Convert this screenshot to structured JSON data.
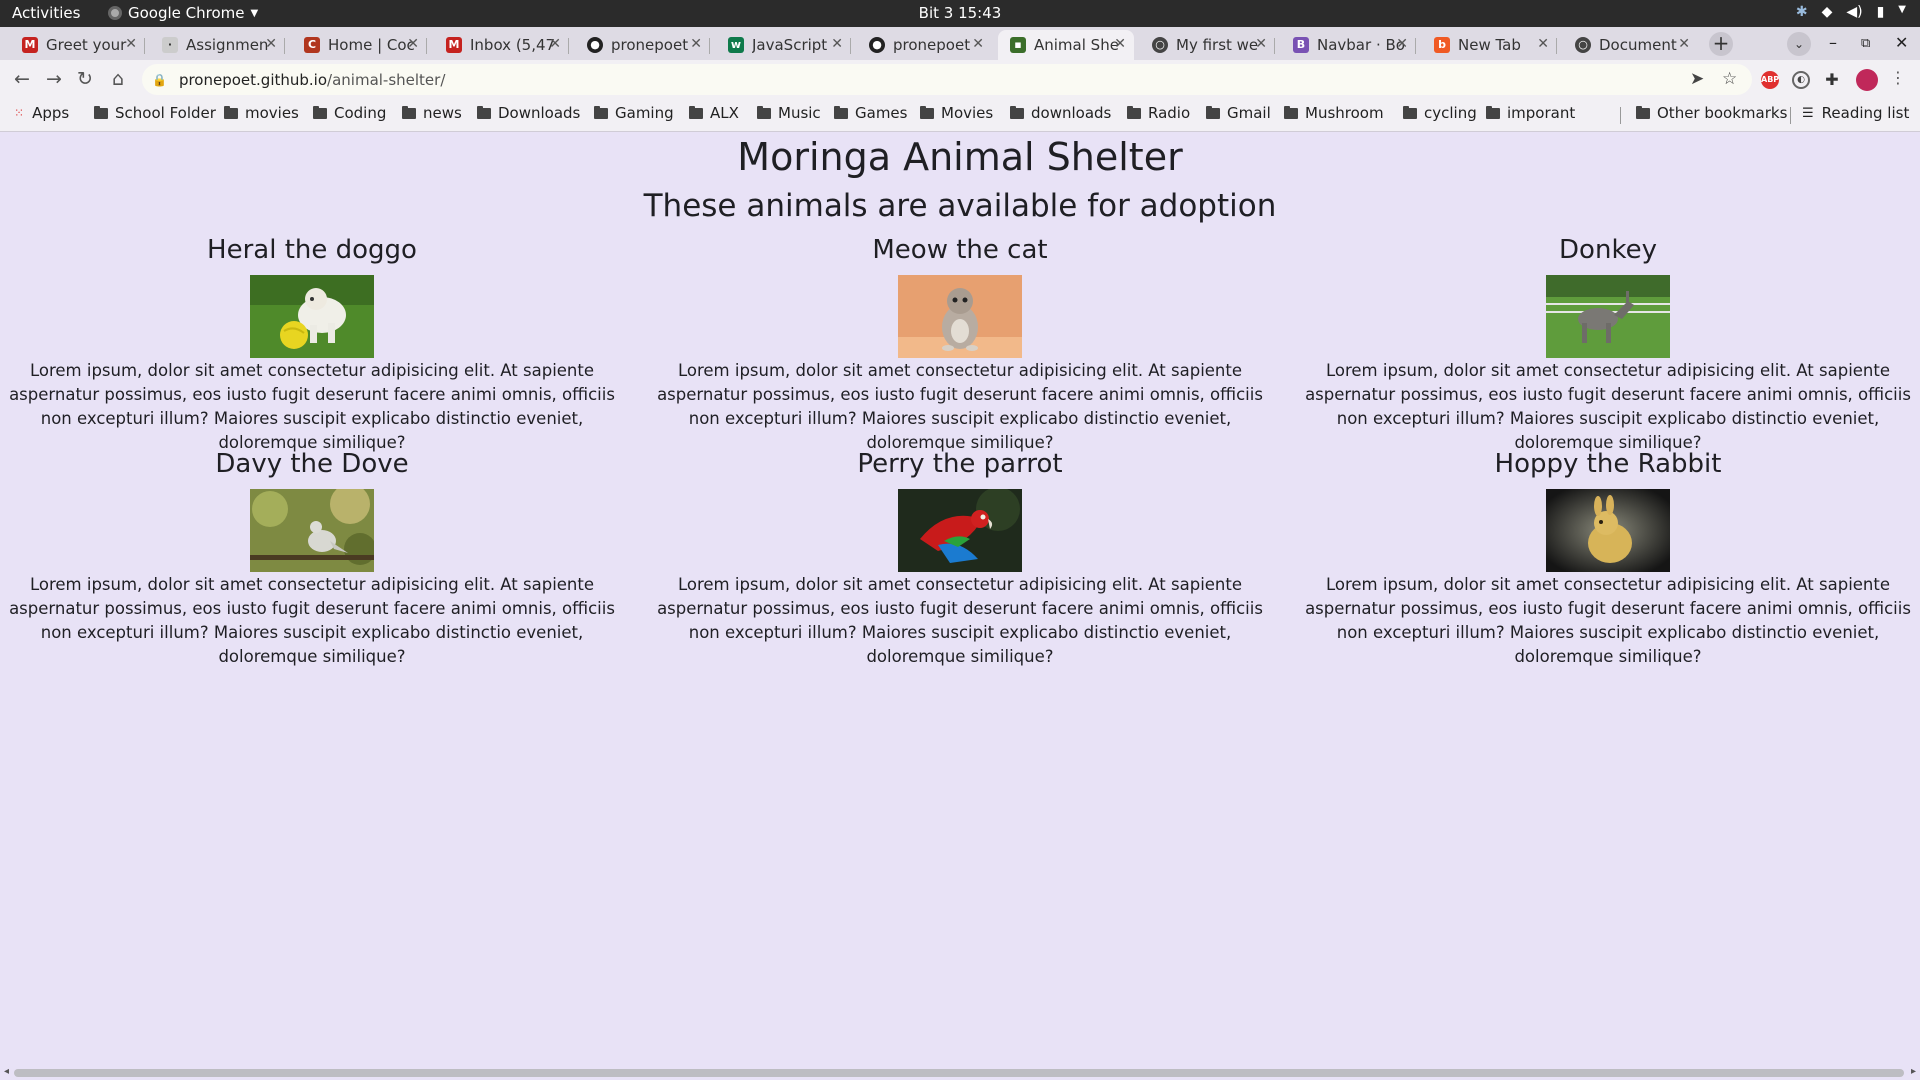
{
  "system": {
    "activities": "Activities",
    "app_name": "Google Chrome",
    "clock": "Bit 3  15:43"
  },
  "tabs": [
    {
      "title": "Greet your",
      "active": false,
      "favicon": "gmail-icon",
      "color": "#c5221f"
    },
    {
      "title": "Assignmen",
      "active": false,
      "favicon": "assignment-icon",
      "color": "#777777"
    },
    {
      "title": "Home | Coc",
      "active": false,
      "favicon": "codewars-icon",
      "color": "#b1361e"
    },
    {
      "title": "Inbox (5,47",
      "active": false,
      "favicon": "gmail-icon",
      "color": "#c5221f"
    },
    {
      "title": "pronepoet",
      "active": false,
      "favicon": "github-icon",
      "color": "#222222"
    },
    {
      "title": "JavaScript",
      "active": false,
      "favicon": "js-icon",
      "color": "#0f7a4b"
    },
    {
      "title": "pronepoet",
      "active": false,
      "favicon": "github-icon",
      "color": "#222222"
    },
    {
      "title": "Animal She",
      "active": true,
      "favicon": "page-icon",
      "color": "#3b6e2a"
    },
    {
      "title": "My first we",
      "active": false,
      "favicon": "globe-icon",
      "color": "#444444"
    },
    {
      "title": "Navbar · Bo",
      "active": false,
      "favicon": "bootstrap-icon",
      "color": "#7952b3"
    },
    {
      "title": "New Tab",
      "active": false,
      "favicon": "brave-icon",
      "color": "#f05a24"
    },
    {
      "title": "Document",
      "active": false,
      "favicon": "globe-icon",
      "color": "#444444"
    }
  ],
  "address": {
    "host": "pronepoet.github.io",
    "path": "/animal-shelter/"
  },
  "bookmarks": {
    "apps": "Apps",
    "items": [
      "School Folder",
      "movies",
      "Coding",
      "news",
      "Downloads",
      "Gaming",
      "ALX",
      "Music",
      "Games",
      "Movies",
      "downloads",
      "Radio",
      "Gmail",
      "Mushroom",
      "cycling",
      "imporant"
    ],
    "other": "Other bookmarks",
    "reading": "Reading list"
  },
  "page": {
    "title": "Moringa Animal Shelter",
    "subtitle": "These animals are available for adoption",
    "lorem": "Lorem ipsum, dolor sit amet consectetur adipisicing elit. At sapiente aspernatur possimus, eos iusto fugit deserunt facere animi omnis, officiis non excepturi illum? Maiores suscipit explicabo distinctio eveniet, doloremque similique?",
    "animals": [
      {
        "name": "Heral the doggo",
        "image": "dog-photo"
      },
      {
        "name": "Meow the cat",
        "image": "cat-photo"
      },
      {
        "name": "Donkey",
        "image": "donkey-photo"
      },
      {
        "name": "Davy the Dove",
        "image": "dove-photo"
      },
      {
        "name": "Perry the parrot",
        "image": "parrot-photo"
      },
      {
        "name": "Hoppy the Rabbit",
        "image": "rabbit-photo"
      }
    ]
  }
}
